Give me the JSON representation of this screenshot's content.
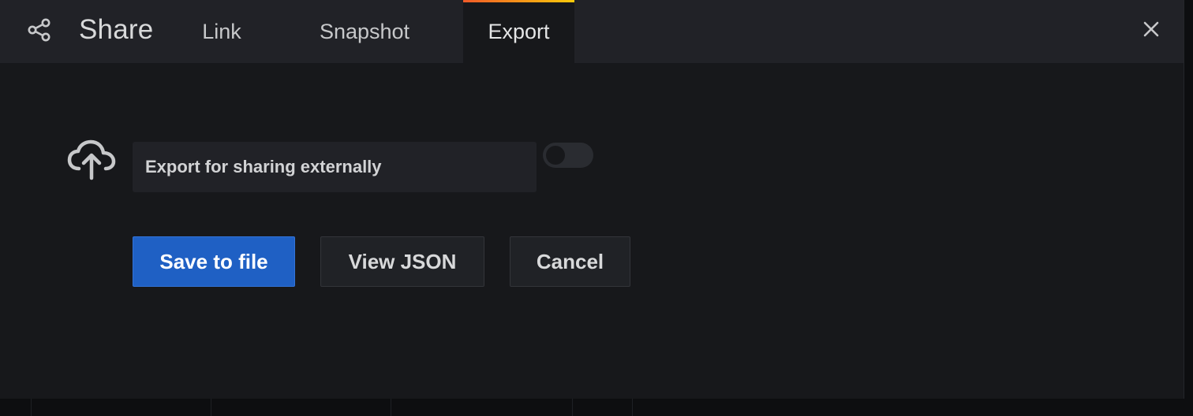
{
  "modal": {
    "title": "Share",
    "icons": {
      "share": "share-icon",
      "close": "close-icon",
      "export": "cloud-upload-icon"
    },
    "tabs": [
      {
        "label": "Link",
        "active": false
      },
      {
        "label": "Snapshot",
        "active": false
      },
      {
        "label": "Export",
        "active": true
      }
    ]
  },
  "export": {
    "toggle_label": "Export for sharing externally",
    "toggle_on": false,
    "buttons": {
      "save": "Save to file",
      "view_json": "View JSON",
      "cancel": "Cancel"
    }
  },
  "colors": {
    "primary_button": "#1f60c4",
    "active_tab_gradient_start": "#f05a28",
    "active_tab_gradient_end": "#fbca0a"
  }
}
